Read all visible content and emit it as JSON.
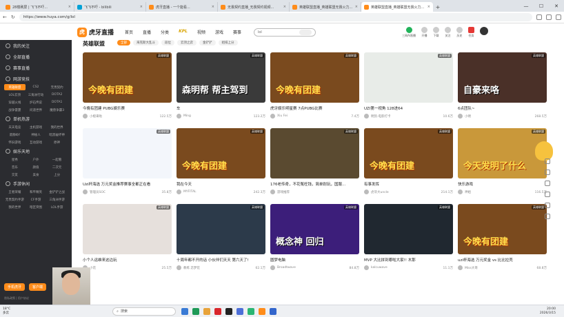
{
  "browser": {
    "tabs": [
      {
        "label": "28楼刷屏 | 飞飞不吓...",
        "color": "#ff8c1a",
        "active": false
      },
      {
        "label": "飞飞不吓 - bilibili",
        "color": "#00a1d6",
        "active": false
      },
      {
        "label": "虎牙直播 - 一个能看...",
        "color": "#ff8c1a",
        "active": false
      },
      {
        "label": "无畏契约直播_无畏契约视频...",
        "color": "#ff8c1a",
        "active": false
      },
      {
        "label": "英雄联盟直播_英雄联盟无畏火力...",
        "color": "#ff8c1a",
        "active": false
      },
      {
        "label": "英雄联盟直播_英雄联盟无畏火力...",
        "color": "#ff8c1a",
        "active": true
      }
    ],
    "url": "https://www.huya.com/g/lol"
  },
  "site": {
    "logo": "虎牙直播",
    "nav": [
      "首页",
      "直播",
      "分类",
      "KPL",
      "视频",
      "游戏",
      "赛事"
    ],
    "search_value": "lol",
    "user_icons": [
      "三网AI直播",
      "开播",
      "下载",
      "关注",
      "历史",
      "任务"
    ]
  },
  "sidebar": {
    "sections": [
      {
        "label": "我的关注"
      },
      {
        "label": "全部直播"
      },
      {
        "label": "赛事直播"
      },
      {
        "label": "网游竞技"
      }
    ],
    "tags1": [
      "英雄联盟",
      "CS2",
      "无畏契约",
      "LOL云顶",
      "三角洲行动",
      "DOTA2",
      "穿越火线",
      "炉石传说",
      "DOTA1",
      "战争雷霆",
      "问道世界",
      "魔兽争霸3"
    ],
    "section2": "单机热游",
    "tags2": [
      "天天电竞",
      "主机游戏",
      "我的世界",
      "寂静岭f",
      "神秘人",
      "暗黑破坏神",
      "怀旧游戏",
      "互动游戏",
      "原神"
    ],
    "section3": "娱乐天地",
    "tags3": [
      "星秀",
      "户外",
      "一起看",
      "音乐",
      "颜值",
      "二次元",
      "交友",
      "美食",
      "上分"
    ],
    "section4": "手游休闲",
    "tags4": [
      "王者荣耀",
      "和平精英",
      "金铲铲之战",
      "无畏契约手游",
      "CF手游",
      "三角洲手游",
      "我的世界",
      "暗区突围",
      "LOL手游"
    ],
    "bottom_buttons": [
      "手机虎牙",
      "客户端"
    ],
    "footer": "隐私政策 | 用户协议"
  },
  "content": {
    "channel_title": "英雄联盟",
    "filters": [
      "全部",
      "海克斯大乱斗",
      "段位",
      "云顶之弈",
      "金铲铲",
      "组排上分"
    ],
    "cards": [
      {
        "title": "今晚有团建 PUBG娱乐赛",
        "user": "小橙来啦",
        "count": "122.5万",
        "badge": "英雄联盟",
        "bg": "#7a4a1e",
        "big": "今晚有团建"
      },
      {
        "title": "车",
        "user": "Ming",
        "count": "123.2万",
        "badge": "英雄联盟",
        "bg": "#3a3a3a",
        "big": "森明帮 帮主驾到",
        "white": true
      },
      {
        "title": "虎牙娱乐明星赛 7点PUBG比赛",
        "user": "Xiu Fei",
        "count": "7.4万",
        "badge": "英雄联盟",
        "bg": "#7a4a1e",
        "big": "今晚有团建"
      },
      {
        "title": "UZI第一视角 128进64",
        "user": "明凯-电影打卡",
        "count": "10.6万",
        "badge": "英雄联盟",
        "bg": "#e8ece8",
        "big": ""
      },
      {
        "title": "6点团队~",
        "user": "小明",
        "count": "268.5万",
        "badge": "英雄联盟",
        "bg": "#4a3028",
        "big": "自豪来咯",
        "white": true
      },
      {
        "title": "Uzi杯海选 万元奖金推荐赛事全都正在看",
        "user": "管理员SOC",
        "count": "35.8万",
        "badge": "英雄联盟",
        "bg": "#f3f6fb",
        "big": ""
      },
      {
        "title": "我在今天",
        "user": "MYFITAL",
        "count": "242.3万",
        "badge": "英雄联盟",
        "bg": "#7a4a1e",
        "big": "今晚有团建"
      },
      {
        "title": "176老传奇，不花冤枉钱，简单耐玩，国服...",
        "user": "游戏推荐",
        "count": "",
        "badge": "英雄联盟",
        "bg": "#5a4a30",
        "big": ""
      },
      {
        "title": "有事发挥",
        "user": "虎牙大uncle",
        "count": "214.1万",
        "badge": "英雄联盟",
        "bg": "#7a4a1e",
        "big": "今晚有团建"
      },
      {
        "title": "快乐游戏",
        "user": "神姐",
        "count": "116.5万",
        "badge": "英雄联盟",
        "bg": "#c9983a",
        "big": "今天发明了什么"
      },
      {
        "title": "小个人运维来这边玩",
        "user": "小花",
        "count": "25.5万",
        "badge": "英雄联盟",
        "bg": "#e6e0dc",
        "big": ""
      },
      {
        "title": "十周年都不开的话 小伙伴们天天 第六天了!",
        "user": "教练 恋梦花",
        "count": "62.1万",
        "badge": "英雄联盟",
        "bg": "#2c3a4a",
        "big": ""
      },
      {
        "title": "圆梦电脑",
        "user": "Broadtwave",
        "count": "84.8万",
        "badge": "英雄联盟",
        "bg": "#3c1e7a",
        "big": "概念神 回归",
        "white": true
      },
      {
        "title": "MVP 大比拼到哪啦大家!! 木那",
        "user": "kalcuwave",
        "count": "11.1万",
        "badge": "英雄联盟",
        "bg": "#202830",
        "big": ""
      },
      {
        "title": "uzi杯海选 万元奖金 vs 比比拉壳",
        "user": "Miss大哥",
        "count": "68.8万",
        "badge": "英雄联盟",
        "bg": "#7a4a1e",
        "big": "今晚有团建"
      }
    ]
  },
  "taskbar": {
    "weather_temp": "18°C",
    "weather_desc": "多云",
    "search_placeholder": "搜索",
    "time": "20:00",
    "date": "2026/3/15"
  }
}
